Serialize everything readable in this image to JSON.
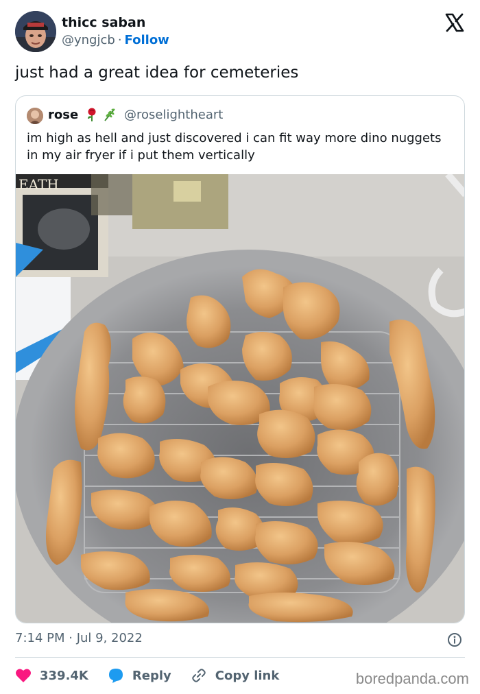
{
  "author": {
    "name": "thicc saban",
    "handle": "@yngjcb",
    "follow_label": "Follow"
  },
  "tweet": {
    "text": "just had a great idea for cemeteries",
    "timestamp": "7:14 PM · Jul 9, 2022"
  },
  "quoted": {
    "name": "rose",
    "emojis": [
      "rose-emoji",
      "herb-emoji"
    ],
    "handle": "@roselightheart",
    "text": "im high as hell and just discovered i can fit way more dino nuggets in my air fryer if i put them vertically",
    "photo_label": "Photo of dinosaur-shaped chicken nuggets standing vertically on a wire rack inside an air fryer basket"
  },
  "actions": {
    "likes": "339.4K",
    "reply_label": "Reply",
    "copy_label": "Copy link"
  },
  "watermark": "boredpanda.com",
  "colors": {
    "like": "#f91880",
    "reply": "#1d9bf0",
    "link": "#006fd6",
    "muted": "#536471"
  }
}
